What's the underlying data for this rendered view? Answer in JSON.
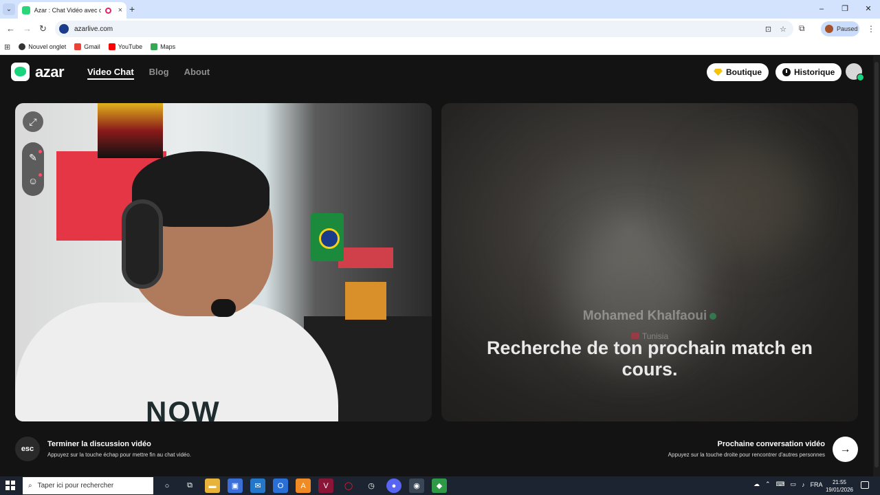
{
  "browser": {
    "tab_title": "Azar : Chat Vidéo avec de n",
    "tab_close": "×",
    "new_tab": "+",
    "url": "azarlive.com",
    "profile_status": "Paused",
    "window_controls": [
      "–",
      "❐",
      "✕"
    ],
    "bookmarks": [
      {
        "label": "Nouvel onglet",
        "icon": "chrome-icon",
        "color": "#333333"
      },
      {
        "label": "Gmail",
        "icon": "gmail-icon",
        "color": "#ea4335"
      },
      {
        "label": "YouTube",
        "icon": "youtube-icon",
        "color": "#ff0000"
      },
      {
        "label": "Maps",
        "icon": "maps-icon",
        "color": "#34a853"
      }
    ]
  },
  "app": {
    "logo_text": "azar",
    "nav": {
      "video_chat": "Video Chat",
      "blog": "Blog",
      "about": "About"
    },
    "boutique_label": "Boutique",
    "historique_label": "Historique",
    "peer": {
      "name": "Mohamed Khalfaoui",
      "country": "Tunisia"
    },
    "search_status": "Recherche de ton prochain match en cours.",
    "self_video_text": "NOW",
    "end_chat": {
      "key": "esc",
      "title": "Terminer la discussion vidéo",
      "subtitle": "Appuyez sur la touche échap pour mettre fin au chat vidéo."
    },
    "next_chat": {
      "title": "Prochaine conversation vidéo",
      "subtitle": "Appuyez sur la touche droite pour rencontrer d'autres personnes"
    },
    "colors": {
      "brand_green": "#19d47c",
      "background": "#131313",
      "diamond": "#f7c20c"
    }
  },
  "taskbar": {
    "search_placeholder": "Taper ici pour rechercher",
    "language": "FRA",
    "time": "21:55",
    "date": "19/01/2026"
  }
}
